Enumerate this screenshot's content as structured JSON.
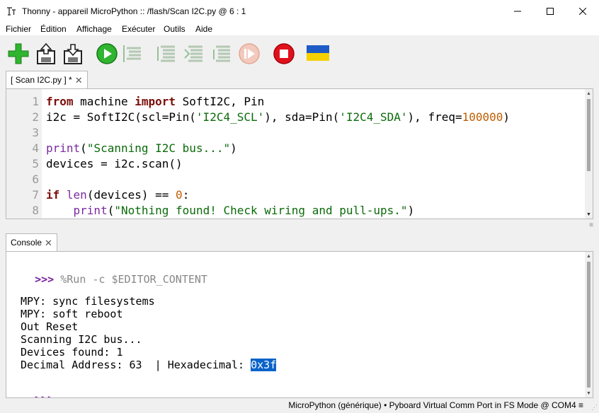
{
  "window": {
    "title": "Thonny  -  appareil MicroPython :: /flash/Scan I2C.py  @  6 : 1",
    "minimize_icon": "minimize-icon",
    "maximize_icon": "maximize-icon",
    "close_icon": "close-icon"
  },
  "menu": [
    "Fichier",
    "Édition",
    "Affichage",
    "Exécuter",
    "Outils",
    "Aide"
  ],
  "toolbar": {
    "buttons": [
      "new-file-icon",
      "open-file-icon",
      "save-file-icon",
      "run-icon",
      "debug-icon",
      "step-over-icon",
      "step-into-icon",
      "step-out-icon",
      "resume-icon",
      "stop-icon",
      "ukraine-flag-icon"
    ]
  },
  "editor": {
    "tab_label": "[ Scan I2C.py ] *",
    "line_numbers": [
      "1",
      "2",
      "3",
      "4",
      "5",
      "6",
      "7",
      "8"
    ],
    "lines": [
      "from machine import SoftI2C, Pin",
      "i2c = SoftI2C(scl=Pin('I2C4_SCL'), sda=Pin('I2C4_SDA'), freq=100000)",
      "",
      "print(\"Scanning I2C bus...\")",
      "devices = i2c.scan()",
      "",
      "if len(devices) == 0:",
      "    print(\"Nothing found! Check wiring and pull-ups.\")"
    ]
  },
  "console": {
    "tab_label": "Console",
    "prompt": ">>>",
    "command": "%Run -c $EDITOR_CONTENT",
    "output": [
      "MPY: sync filesystems",
      "MPY: soft reboot",
      "Out Reset",
      "Scanning I2C bus...",
      "Devices found: 1"
    ],
    "last_line_prefix": "Decimal Address: 63  | Hexadecimal: ",
    "last_line_selected": "0x3f"
  },
  "status": {
    "text": "MicroPython (générique)  •  Pyboard Virtual Comm Port in FS Mode @ COM4  ≡"
  },
  "colors": {
    "keyword": "#7a0f0a",
    "string": "#0a6b0a",
    "number": "#c05e00",
    "prompt": "#7a1fa0",
    "selection": "#0a63c9"
  }
}
